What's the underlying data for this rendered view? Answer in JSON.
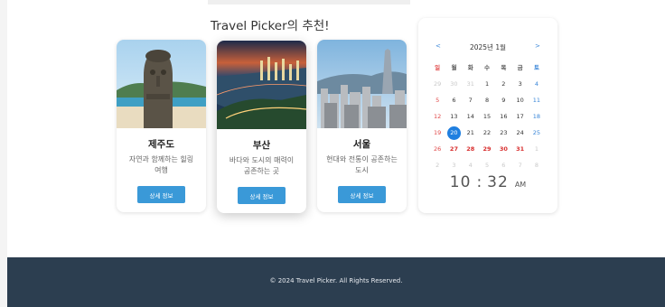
{
  "section": {
    "title": "Travel Picker의 추천!"
  },
  "cards": [
    {
      "name": "제주도",
      "description": "자연과 함께하는 힐링 여행",
      "button": "상세 정보"
    },
    {
      "name": "부산",
      "description": "바다와 도시의 매력이 공존하는 곳",
      "button": "상세 정보"
    },
    {
      "name": "서울",
      "description": "현대와 전통이 공존하는 도시",
      "button": "상세 정보"
    }
  ],
  "calendar": {
    "prev": "<",
    "next": ">",
    "month": "2025년 1월",
    "weekdays": [
      "일",
      "월",
      "화",
      "수",
      "목",
      "금",
      "토"
    ],
    "days": [
      "29",
      "30",
      "31",
      "1",
      "2",
      "3",
      "4",
      "5",
      "6",
      "7",
      "8",
      "9",
      "10",
      "11",
      "12",
      "13",
      "14",
      "15",
      "16",
      "17",
      "18",
      "19",
      "20",
      "21",
      "22",
      "23",
      "24",
      "25",
      "26",
      "27",
      "28",
      "29",
      "30",
      "31",
      "1",
      "2",
      "3",
      "4",
      "5",
      "6",
      "7",
      "8"
    ],
    "today": "20",
    "clock": {
      "hour": "10",
      "separator": ":",
      "minute": "32",
      "ampm": "AM"
    }
  },
  "footer": {
    "text": "© 2024 Travel Picker. All Rights Reserved."
  },
  "colors": {
    "accent": "#3a99d8",
    "footer_bg": "#2c3e50",
    "today": "#1f7fe0",
    "sunday": "#e04848",
    "saturday": "#3a86d8"
  }
}
